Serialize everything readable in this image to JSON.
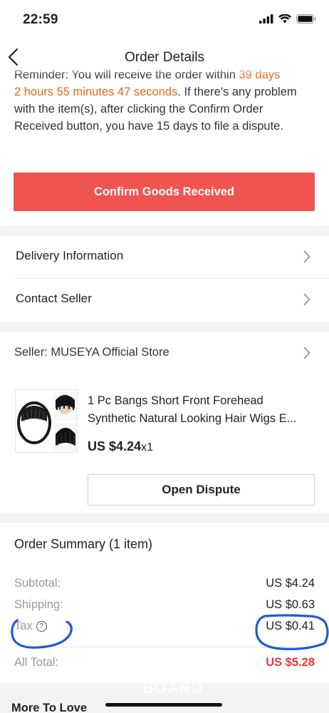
{
  "status_bar": {
    "time": "22:59"
  },
  "nav": {
    "title": "Order Details"
  },
  "reminder": {
    "lead": "Reminder: You will receive the order within ",
    "countdown_a": "39 days",
    "countdown_b": "2 hours 55 minutes 47 seconds",
    "tail": ". If there's any problem with the item(s), after clicking the Confirm Order Received button, you have 15 days to file a dispute."
  },
  "confirm_button": "Confirm Goods Received",
  "menu": {
    "delivery": "Delivery Information",
    "contact": "Contact Seller"
  },
  "seller": {
    "label": "Seller: MUSEYA Official Store"
  },
  "product": {
    "name": "1 Pc Bangs Short Front Forehead Synthetic Natural Looking Hair Wigs E...",
    "price": "US $4.24",
    "qty": "x1"
  },
  "dispute_button": "Open Dispute",
  "summary": {
    "title": "Order Summary (1 item)",
    "subtotal_label": "Subtotal:",
    "subtotal_value": "US $4.24",
    "shipping_label": "Shipping:",
    "shipping_value": "US $0.63",
    "tax_label": "Tax",
    "tax_value": "US $0.41",
    "total_label": "All Total:",
    "total_value": "US $5.28"
  },
  "more": {
    "title": "More To Love"
  },
  "watermark": "BOARD",
  "colors": {
    "accent": "#ef5451",
    "orange": "#e8671a",
    "total": "#e53935",
    "annotation": "#1e5bd8"
  }
}
